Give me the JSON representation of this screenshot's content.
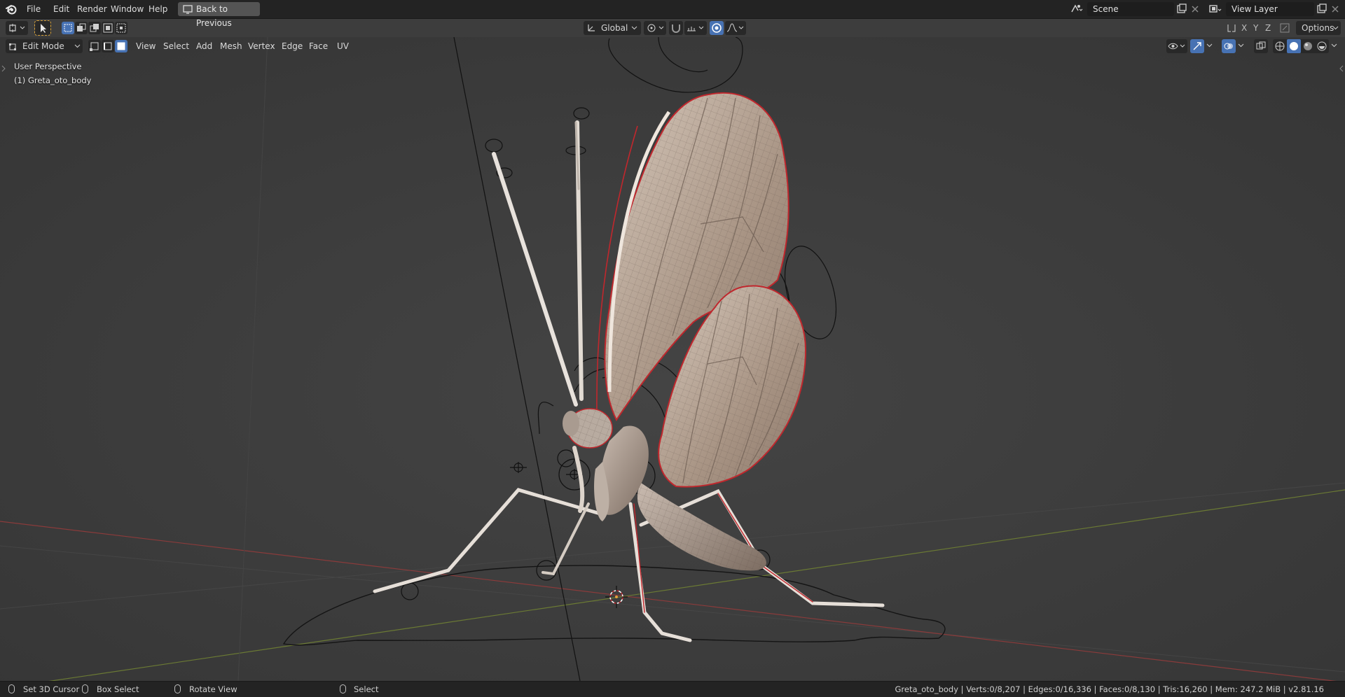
{
  "topbar": {
    "menus": [
      "File",
      "Edit",
      "Render",
      "Window",
      "Help"
    ],
    "back_button": "Back to Previous",
    "scene_name": "Scene",
    "view_layer": "View Layer"
  },
  "toolheader": {
    "orientation": "Global",
    "options": "Options",
    "axes": [
      "X",
      "Y",
      "Z"
    ]
  },
  "editor_header": {
    "mode": "Edit Mode",
    "menus": [
      "View",
      "Select",
      "Add",
      "Mesh",
      "Vertex",
      "Edge",
      "Face",
      "UV"
    ]
  },
  "viewport": {
    "perspective": "User Perspective",
    "object": "(1) Greta_oto_body"
  },
  "statusbar": {
    "left_click": "Set 3D Cursor",
    "drag": "Box Select",
    "middle": "Rotate View",
    "right": "Select",
    "stats": "Greta_oto_body | Verts:0/8,207 | Edges:0/16,336 | Faces:0/8,130 | Tris:16,260 | Mem: 247.2 MiB | v2.81.16"
  },
  "colors": {
    "accent": "#4772b3",
    "selected_edge": "#c1272d",
    "x_axis": "#8a3b3b",
    "y_axis": "#6b7a34"
  }
}
